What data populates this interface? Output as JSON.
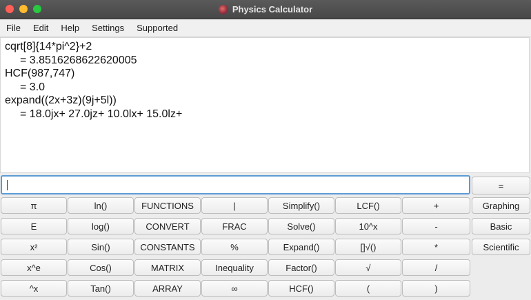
{
  "window": {
    "title": "Physics Calculator"
  },
  "menu": [
    "File",
    "Edit",
    "Help",
    "Settings",
    "Supported"
  ],
  "output": {
    "lines": [
      {
        "text": "cqrt[8]{14*pi^2}+2",
        "result": false
      },
      {
        "text": "= 3.8516268622620005",
        "result": true
      },
      {
        "text": "HCF(987,747)",
        "result": false
      },
      {
        "text": "= 3.0",
        "result": true
      },
      {
        "text": "expand((2x+3z)(9j+5l))",
        "result": false
      },
      {
        "text": "= 18.0jx+ 27.0jz+ 10.0lx+ 15.0lz+",
        "result": true
      }
    ]
  },
  "input": {
    "value": ""
  },
  "equals_label": "=",
  "buttons": [
    [
      "π",
      "ln()",
      "FUNCTIONS",
      "|",
      "Simplify()",
      "LCF()",
      "+",
      "Graphing"
    ],
    [
      "E",
      "log()",
      "CONVERT",
      "FRAC",
      "Solve()",
      "10^x",
      "-",
      "Basic"
    ],
    [
      "x²",
      "Sin()",
      "CONSTANTS",
      "%",
      "Expand()",
      "[]√()",
      "*",
      "Scientific"
    ],
    [
      "x^e",
      "Cos()",
      "MATRIX",
      "Inequality",
      "Factor()",
      "√",
      "/"
    ],
    [
      "^x",
      "Tan()",
      "ARRAY",
      "∞",
      "HCF()",
      "(",
      ")"
    ]
  ]
}
